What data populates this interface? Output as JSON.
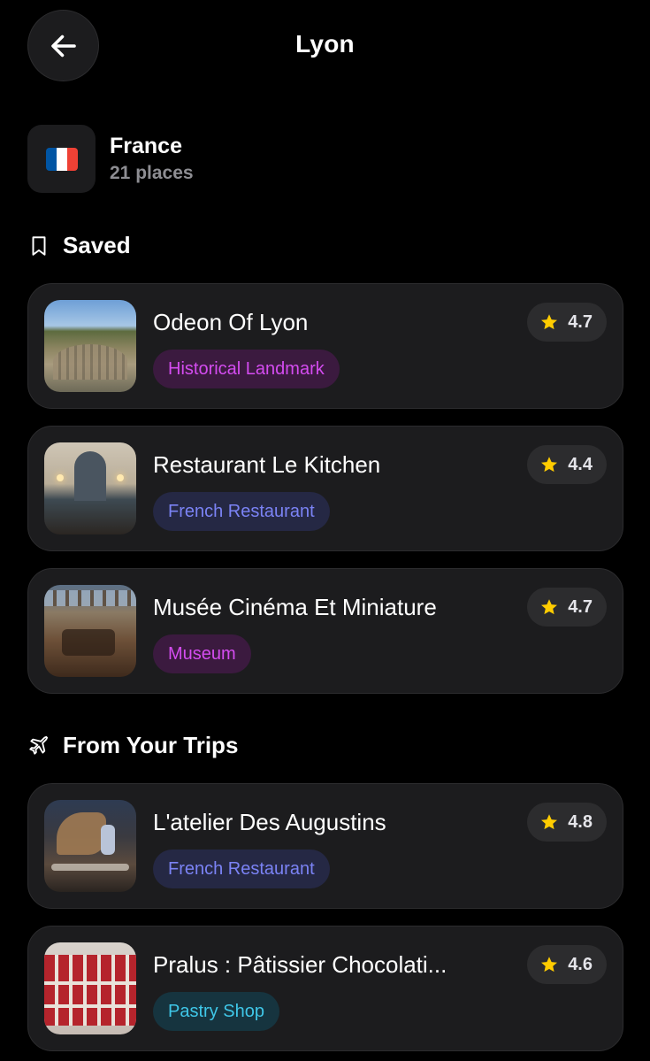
{
  "header": {
    "title": "Lyon",
    "back_icon": "arrow-left-icon"
  },
  "country": {
    "name": "France",
    "count": "21 places",
    "flag_colors": [
      "#0055A4",
      "#FFFFFF",
      "#EF4135"
    ]
  },
  "sections": [
    {
      "title": "Saved",
      "icon": "bookmark-icon",
      "items": [
        {
          "name": "Odeon Of Lyon",
          "tag": "Historical Landmark",
          "rating": "4.7"
        },
        {
          "name": "Restaurant Le Kitchen",
          "tag": "French Restaurant",
          "rating": "4.4"
        },
        {
          "name": "Musée Cinéma Et Miniature",
          "tag": "Museum",
          "rating": "4.7"
        }
      ]
    },
    {
      "title": "From Your Trips",
      "icon": "airplane-icon",
      "items": [
        {
          "name": "L'atelier Des Augustins",
          "tag": "French Restaurant",
          "rating": "4.8"
        },
        {
          "name": "Pralus : Pâtissier Chocolati...",
          "tag": "Pastry Shop",
          "rating": "4.6"
        }
      ]
    }
  ],
  "colors": {
    "star": "#FFCC00",
    "tag_historical": "#D44CF0",
    "tag_french": "#7B83F5",
    "tag_museum": "#D44CF0",
    "tag_pastry": "#3FC7E8"
  }
}
